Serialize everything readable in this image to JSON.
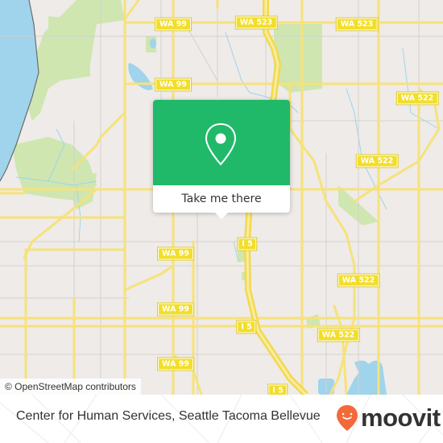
{
  "map": {
    "attribution": "© OpenStreetMap contributors",
    "colors": {
      "land": "#efebe8",
      "water": "#9fd4ec",
      "park": "#cfe6b1",
      "major_road": "#f6e27a",
      "minor_road": "#d6d0cb",
      "highlight_green": "#20b96a"
    },
    "shields": [
      {
        "label": "WA 99",
        "id": "wa99-top"
      },
      {
        "label": "WA 523",
        "id": "wa523-left"
      },
      {
        "label": "WA 523",
        "id": "wa523-right"
      },
      {
        "label": "WA 99",
        "id": "wa99-2"
      },
      {
        "label": "WA 522",
        "id": "wa522-ne"
      },
      {
        "label": "WA 522",
        "id": "wa522-mid"
      },
      {
        "label": "WA 99",
        "id": "wa99-3"
      },
      {
        "label": "I 5",
        "id": "i5-1"
      },
      {
        "label": "WA 522",
        "id": "wa522-lower"
      },
      {
        "label": "WA 99",
        "id": "wa99-4"
      },
      {
        "label": "I 5",
        "id": "i5-2"
      },
      {
        "label": "WA 522",
        "id": "wa522-bottom"
      },
      {
        "label": "WA 99",
        "id": "wa99-5"
      },
      {
        "label": "I 5",
        "id": "i5-3"
      }
    ]
  },
  "popup": {
    "icon": "location-pin-icon",
    "button_label": "Take me there"
  },
  "footer": {
    "title": "Center for Human Services, Seattle Tacoma Bellevue",
    "logo_text": "moovit",
    "logo_icon": "moovit-pin-icon",
    "logo_color": "#f26a3a"
  }
}
